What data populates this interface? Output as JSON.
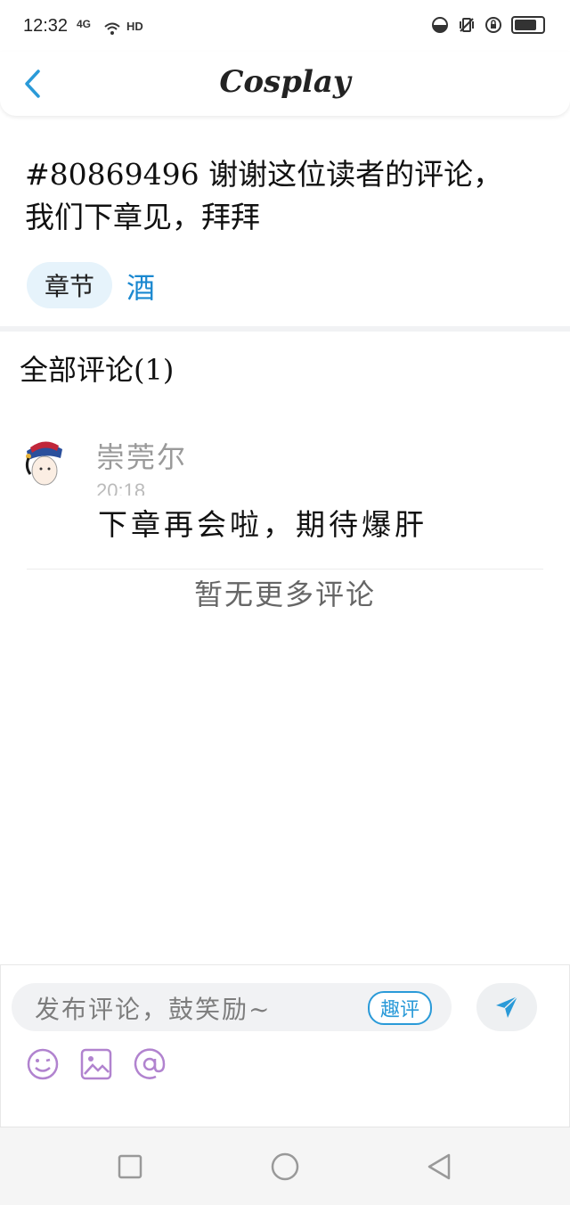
{
  "status_bar": {
    "time": "12:32",
    "network": "4G",
    "hd": "HD"
  },
  "header": {
    "title": "Cosplay"
  },
  "post": {
    "text": "#80869496 谢谢这位读者的评论，我们下章见，拜拜",
    "chip_label": "章节",
    "tag": "酒"
  },
  "comments": {
    "title": "全部评论(1)",
    "items": [
      {
        "user": "崇莞尔",
        "time": "20:18",
        "text": "下章再会啦，期待爆肝"
      }
    ],
    "no_more": "暂无更多评论"
  },
  "composer": {
    "placeholder": "发布评论，鼓笑励~",
    "quping_label": "趣评"
  },
  "colors": {
    "accent": "#1a88d0",
    "chip_bg": "#e6f3fb",
    "tool_icon": "#b183cf"
  }
}
